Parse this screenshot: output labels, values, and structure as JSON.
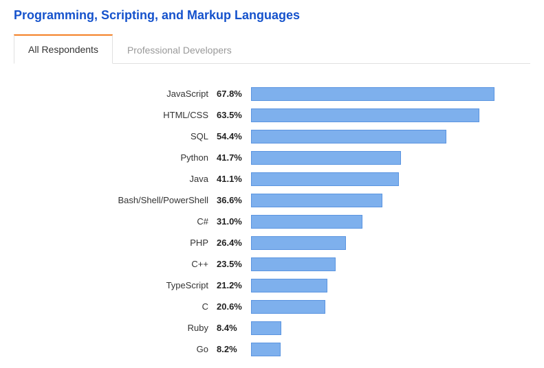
{
  "title": "Programming, Scripting, and Markup Languages",
  "tabs": [
    {
      "label": "All Respondents",
      "active": true
    },
    {
      "label": "Professional Developers",
      "active": false
    }
  ],
  "chart_data": {
    "type": "bar",
    "title": "Programming, Scripting, and Markup Languages",
    "xlabel": "",
    "ylabel": "",
    "xlim": [
      0,
      70
    ],
    "categories": [
      "JavaScript",
      "HTML/CSS",
      "SQL",
      "Python",
      "Java",
      "Bash/Shell/PowerShell",
      "C#",
      "PHP",
      "C++",
      "TypeScript",
      "C",
      "Ruby",
      "Go"
    ],
    "values": [
      67.8,
      63.5,
      54.4,
      41.7,
      41.1,
      36.6,
      31.0,
      26.4,
      23.5,
      21.2,
      20.6,
      8.4,
      8.2
    ],
    "value_suffix": "%"
  }
}
